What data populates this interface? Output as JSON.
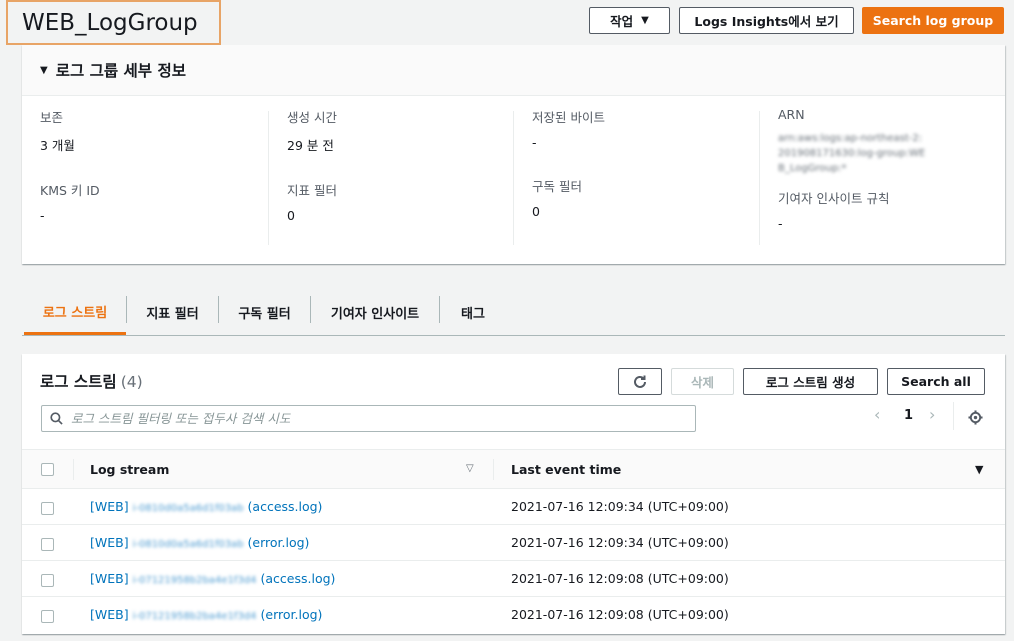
{
  "header": {
    "title": "WEB_LogGroup",
    "actions_label": "작업",
    "insights_label": "Logs Insights에서 보기",
    "search_label": "Search log group"
  },
  "details": {
    "section_title": "로그 그룹 세부 정보",
    "retention_label": "보존",
    "retention_value": "3 개월",
    "kms_label": "KMS 키 ID",
    "kms_value": "-",
    "created_label": "생성 시간",
    "created_value": "29 분 전",
    "metric_label": "지표 필터",
    "metric_value": "0",
    "stored_label": "저장된 바이트",
    "stored_value": "-",
    "sub_label": "구독 필터",
    "sub_value": "0",
    "arn_label": "ARN",
    "arn_value": "arn:aws:logs:ap-northeast-2:201908171630:log-group:WEB_LogGroup:*",
    "contrib_label": "기여자 인사이트 규칙",
    "contrib_value": "-"
  },
  "tabs": [
    "로그 스트림",
    "지표 필터",
    "구독 필터",
    "기여자 인사이트",
    "태그"
  ],
  "streams": {
    "title": "로그 스트림",
    "count": "(4)",
    "delete_label": "삭제",
    "create_label": "로그 스트림 생성",
    "search_all_label": "Search all",
    "search_placeholder": "로그 스트림 필터링 또는 접두사 검색 시도",
    "page": "1",
    "col_stream": "Log stream",
    "col_time": "Last event time",
    "rows": [
      {
        "prefix": "[WEB]",
        "id": "i-0810d0a5a6d1f03ab",
        "suffix": "(access.log)",
        "time": "2021-07-16 12:09:34 (UTC+09:00)"
      },
      {
        "prefix": "[WEB]",
        "id": "i-0810d0a5a6d1f03ab",
        "suffix": "(error.log)",
        "time": "2021-07-16 12:09:34 (UTC+09:00)"
      },
      {
        "prefix": "[WEB]",
        "id": "i-07121958b2ba4e1f3d4",
        "suffix": "(access.log)",
        "time": "2021-07-16 12:09:08 (UTC+09:00)"
      },
      {
        "prefix": "[WEB]",
        "id": "i-07121958b2ba4e1f3d4",
        "suffix": "(error.log)",
        "time": "2021-07-16 12:09:08 (UTC+09:00)"
      }
    ]
  },
  "colors": {
    "accent": "#ec7211",
    "link": "#0073bb"
  }
}
